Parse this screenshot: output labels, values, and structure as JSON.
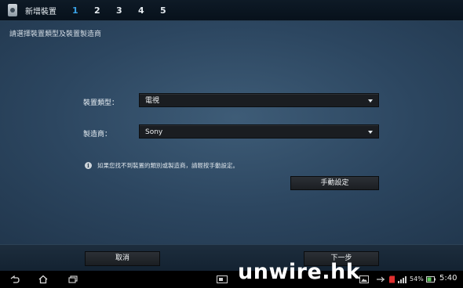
{
  "header": {
    "title": "新增裝置",
    "steps": [
      "1",
      "2",
      "3",
      "4",
      "5"
    ]
  },
  "main": {
    "instruction": "請選擇裝置類型及裝置製造商",
    "device_type": {
      "label": "裝置類型：",
      "value": "電視"
    },
    "manufacturer": {
      "label": "製造商：",
      "value": "Sony"
    },
    "info_text": "如果您找不到裝置的類別或製造商，請輕按手動設定。",
    "manual_button": "手動設定"
  },
  "footer": {
    "cancel_button": "取消",
    "next_button": "下一步"
  },
  "statusbar": {
    "battery": "54%",
    "time": "5:40",
    "watermark": "unwire.hk"
  },
  "colors": {
    "active_step": "#3aa3e8"
  }
}
